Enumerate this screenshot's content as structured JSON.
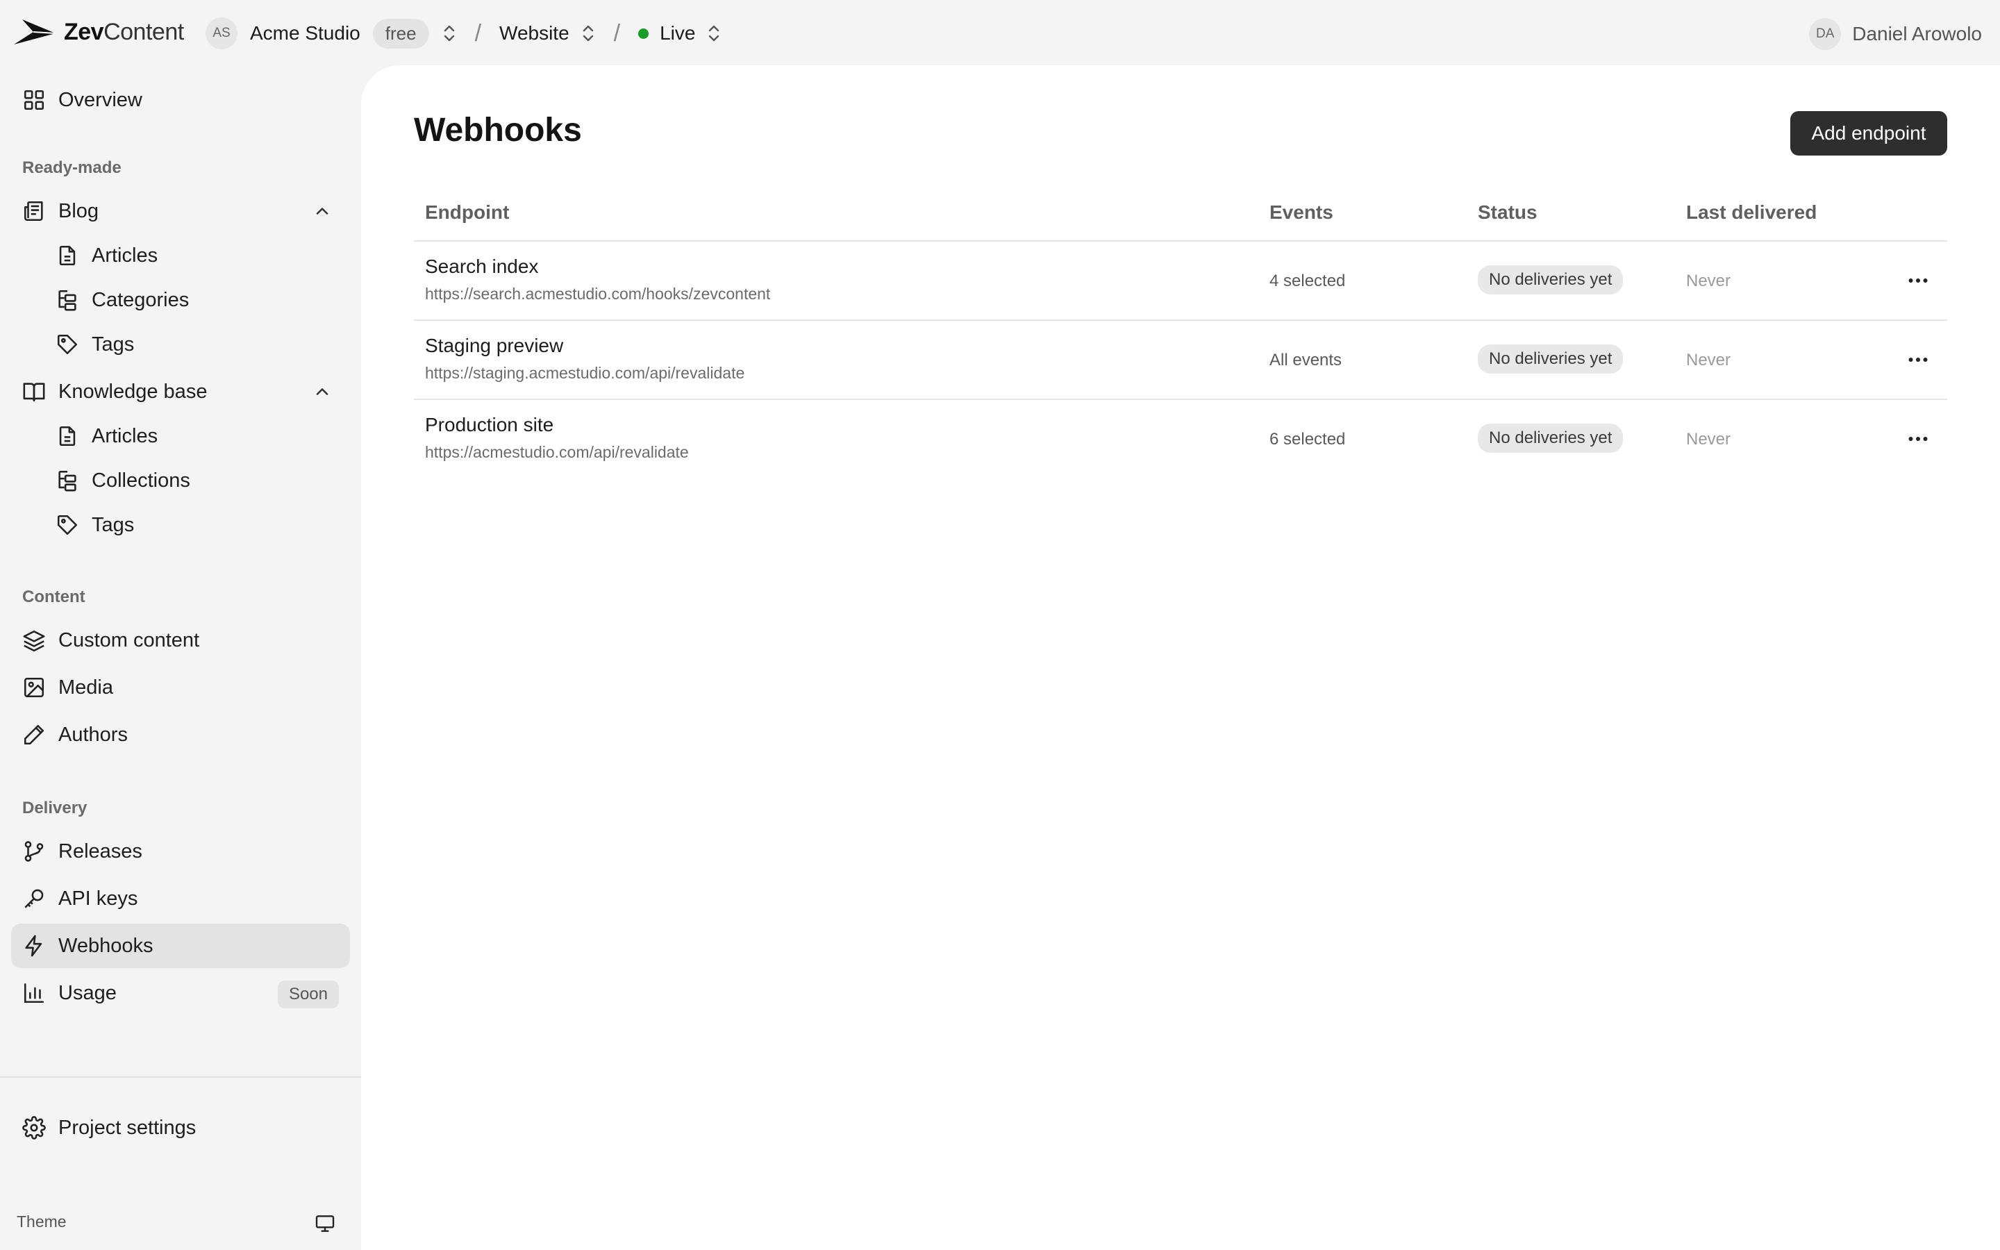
{
  "topbar": {
    "brand_bold": "Zev",
    "brand_light": "Content",
    "org_avatar": "AS",
    "org_name": "Acme Studio",
    "org_plan": "free",
    "project": "Website",
    "environment": "Live",
    "user_avatar": "DA",
    "user_name": "Daniel Arowolo",
    "colors": {
      "live_dot": "#1b9a2c"
    }
  },
  "sidebar": {
    "overview": "Overview",
    "sections": {
      "ready_made": "Ready-made",
      "content": "Content",
      "delivery": "Delivery"
    },
    "blog": {
      "label": "Blog",
      "items": [
        "Articles",
        "Categories",
        "Tags"
      ]
    },
    "knowledge_base": {
      "label": "Knowledge base",
      "items": [
        "Articles",
        "Collections",
        "Tags"
      ]
    },
    "content_items": [
      "Custom content",
      "Media",
      "Authors"
    ],
    "delivery_items": [
      "Releases",
      "API keys",
      "Webhooks",
      "Usage"
    ],
    "usage_badge": "Soon",
    "project_settings": "Project settings",
    "theme_label": "Theme"
  },
  "main": {
    "title": "Webhooks",
    "add_button": "Add endpoint",
    "columns": [
      "Endpoint",
      "Events",
      "Status",
      "Last delivered"
    ],
    "rows": [
      {
        "name": "Search index",
        "url": "https://search.acmestudio.com/hooks/zevcontent",
        "events": "4 selected",
        "status": "No deliveries yet",
        "last": "Never"
      },
      {
        "name": "Staging preview",
        "url": "https://staging.acmestudio.com/api/revalidate",
        "events": "All events",
        "status": "No deliveries yet",
        "last": "Never"
      },
      {
        "name": "Production site",
        "url": "https://acmestudio.com/api/revalidate",
        "events": "6 selected",
        "status": "No deliveries yet",
        "last": "Never"
      }
    ]
  }
}
